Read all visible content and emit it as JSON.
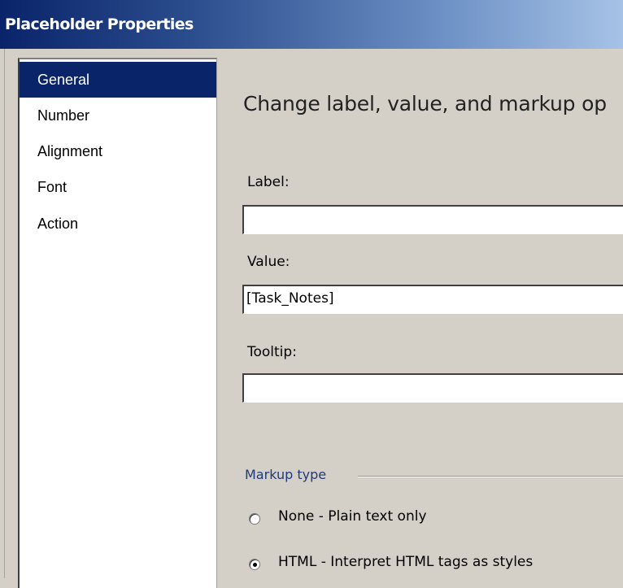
{
  "window": {
    "title": "Placeholder Properties"
  },
  "sidebar": {
    "items": [
      {
        "label": "General",
        "selected": true
      },
      {
        "label": "Number",
        "selected": false
      },
      {
        "label": "Alignment",
        "selected": false
      },
      {
        "label": "Font",
        "selected": false
      },
      {
        "label": "Action",
        "selected": false
      }
    ]
  },
  "main": {
    "heading": "Change label, value, and markup op",
    "label_field": {
      "label": "Label:",
      "value": ""
    },
    "value_field": {
      "label": "Value:",
      "value": "[Task_Notes]"
    },
    "tooltip_field": {
      "label": "Tooltip:",
      "value": ""
    },
    "markup_type": {
      "group_label": "Markup type",
      "options": [
        {
          "label": "None - Plain text only",
          "checked": false
        },
        {
          "label": "HTML - Interpret HTML tags as styles",
          "checked": true
        }
      ]
    }
  },
  "colors": {
    "title_bar_start": "#0a246a",
    "title_bar_end": "#a6c2e6",
    "selection": "#0a246a",
    "dialog_background": "#d4d0c8",
    "group_label": "#1f3a7a"
  }
}
